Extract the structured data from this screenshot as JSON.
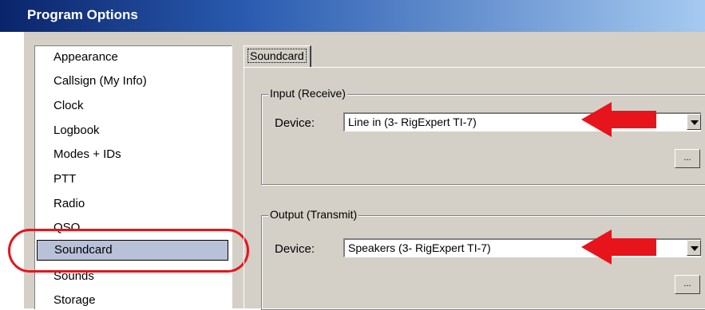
{
  "window": {
    "title": "Program Options"
  },
  "sidebar": {
    "items": [
      {
        "label": "Appearance"
      },
      {
        "label": "Callsign (My Info)"
      },
      {
        "label": "Clock"
      },
      {
        "label": "Logbook"
      },
      {
        "label": "Modes + IDs"
      },
      {
        "label": "PTT"
      },
      {
        "label": "Radio"
      },
      {
        "label": "QSO"
      },
      {
        "label": "Soundcard",
        "selected": true
      },
      {
        "label": "Sounds"
      },
      {
        "label": "Storage"
      }
    ]
  },
  "tabs": [
    {
      "label": "Soundcard"
    }
  ],
  "input_group": {
    "legend": "Input (Receive)",
    "device_label": "Device:",
    "device_value": "Line in (3- RigExpert TI-7)",
    "browse_label": "..."
  },
  "output_group": {
    "legend": "Output (Transmit)",
    "device_label": "Device:",
    "device_value": "Speakers (3- RigExpert TI-7)",
    "browse_label": "..."
  },
  "colors": {
    "highlight": "#e8141c",
    "selection": "#b9c1d9",
    "title_bar": "#0a246a"
  },
  "icons": {
    "dropdown": "chevron-down-icon",
    "annotation": "red-arrow-icon"
  }
}
